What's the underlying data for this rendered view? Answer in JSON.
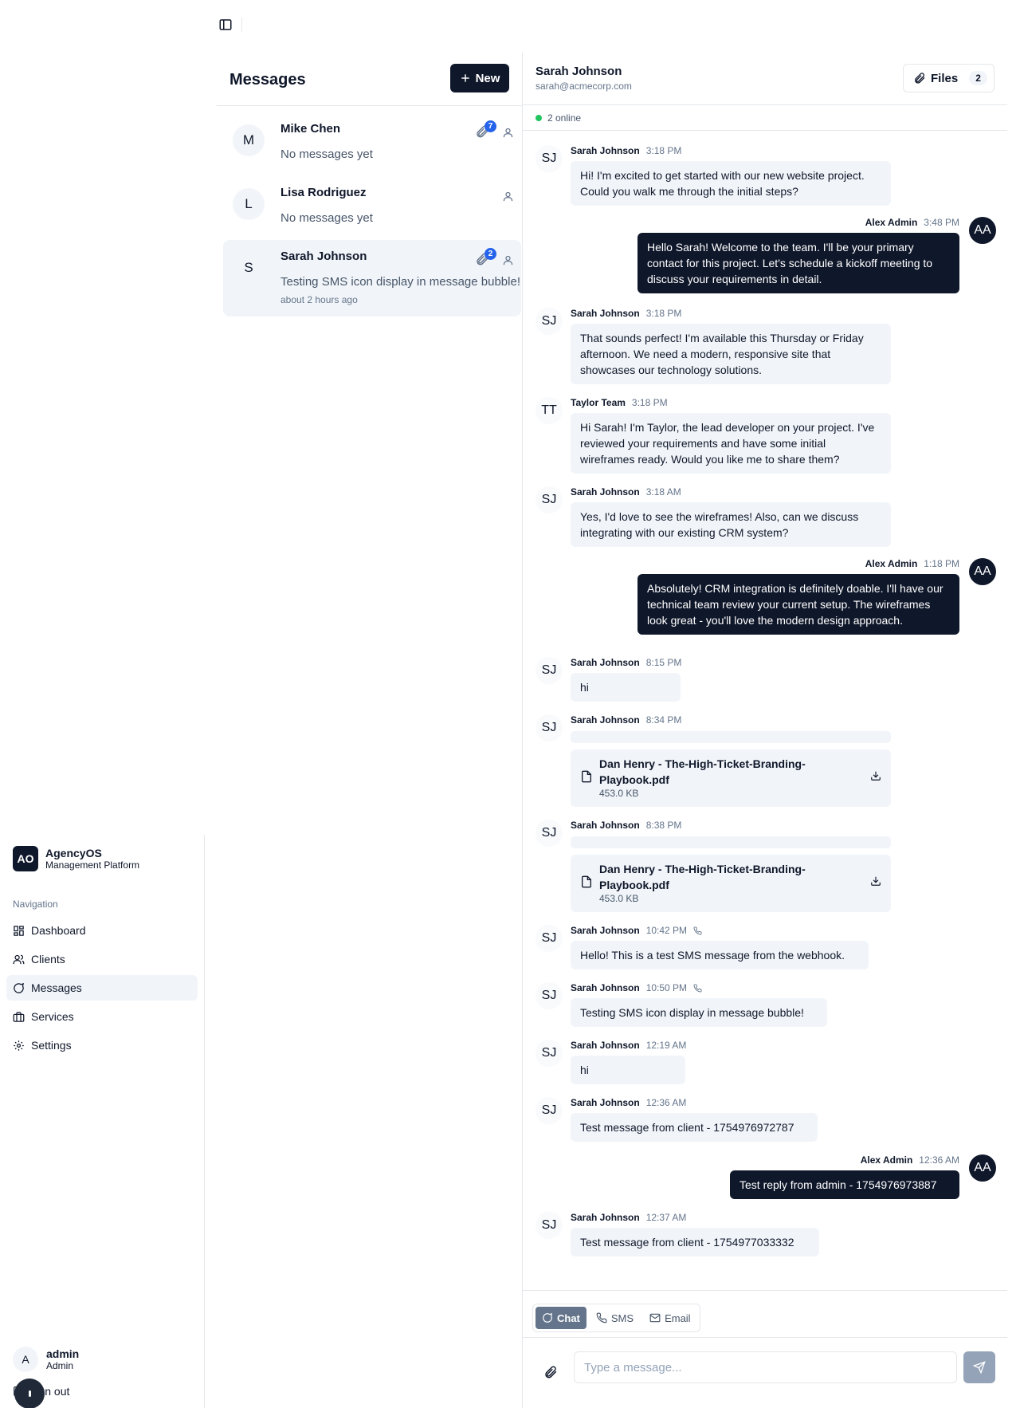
{
  "sidebar": {
    "brand": {
      "logo": "AO",
      "name": "AgencyOS",
      "subtitle": "Management Platform"
    },
    "nav_label": "Navigation",
    "items": [
      {
        "label": "Dashboard",
        "icon": "dashboard-icon"
      },
      {
        "label": "Clients",
        "icon": "users-icon"
      },
      {
        "label": "Messages",
        "icon": "message-icon",
        "active": true
      },
      {
        "label": "Services",
        "icon": "briefcase-icon"
      },
      {
        "label": "Settings",
        "icon": "gear-icon"
      }
    ],
    "user": {
      "avatar": "A",
      "name": "admin",
      "role": "Admin"
    },
    "signout": "Sign out"
  },
  "conversations": {
    "title": "Messages",
    "new_label": "New",
    "items": [
      {
        "avatar": "M",
        "name": "Mike Chen",
        "preview": "No messages yet",
        "time": "",
        "files": "7"
      },
      {
        "avatar": "L",
        "name": "Lisa Rodriguez",
        "preview": "No messages yet",
        "time": ""
      },
      {
        "avatar": "S",
        "name": "Sarah Johnson",
        "preview": "Testing SMS icon display in message bubble!",
        "time": "about 2 hours ago",
        "files": "2",
        "active": true
      }
    ]
  },
  "chat": {
    "contact_name": "Sarah Johnson",
    "contact_email": "sarah@acmecorp.com",
    "files_label": "Files",
    "files_count": "2",
    "online": "2 online",
    "messages": [
      {
        "dir": "in",
        "avatar": "SJ",
        "sender": "Sarah Johnson",
        "time": "3:18 PM",
        "text": "Hi! I'm excited to get started with our new website project. Could you walk me through the initial steps?"
      },
      {
        "dir": "out",
        "avatar": "AA",
        "sender": "Alex Admin",
        "time": "3:48 PM",
        "text": "Hello Sarah! Welcome to the team. I'll be your primary contact for this project. Let's schedule a kickoff meeting to discuss your requirements in detail."
      },
      {
        "dir": "in",
        "avatar": "SJ",
        "sender": "Sarah Johnson",
        "time": "3:18 PM",
        "text": "That sounds perfect! I'm available this Thursday or Friday afternoon. We need a modern, responsive site that showcases our technology solutions."
      },
      {
        "dir": "in",
        "avatar": "TT",
        "sender": "Taylor Team",
        "time": "3:18 PM",
        "text": "Hi Sarah! I'm Taylor, the lead developer on your project. I've reviewed your requirements and have some initial wireframes ready. Would you like me to share them?"
      },
      {
        "dir": "in",
        "avatar": "SJ",
        "sender": "Sarah Johnson",
        "time": "3:18 AM",
        "text": "Yes, I'd love to see the wireframes! Also, can we discuss integrating with our existing CRM system?"
      },
      {
        "dir": "out",
        "avatar": "AA",
        "sender": "Alex Admin",
        "time": "1:18 PM",
        "text": "Absolutely! CRM integration is definitely doable. I'll have our technical team review your current setup. The wireframes look great - you'll love the modern design approach."
      },
      {
        "dir": "in",
        "avatar": "SJ",
        "sender": "Sarah Johnson",
        "time": "8:15 PM",
        "text": "hi"
      },
      {
        "dir": "in",
        "avatar": "SJ",
        "sender": "Sarah Johnson",
        "time": "8:34 PM",
        "file_name": "Dan Henry - The-High-Ticket-Branding-Playbook.pdf",
        "file_size": "453.0 KB"
      },
      {
        "dir": "in",
        "avatar": "SJ",
        "sender": "Sarah Johnson",
        "time": "8:38 PM",
        "file_name": "Dan Henry - The-High-Ticket-Branding-Playbook.pdf",
        "file_size": "453.0 KB"
      },
      {
        "dir": "in",
        "avatar": "SJ",
        "sender": "Sarah Johnson",
        "time": "10:42 PM",
        "sms": true,
        "text": "Hello! This is a test SMS message from the webhook."
      },
      {
        "dir": "in",
        "avatar": "SJ",
        "sender": "Sarah Johnson",
        "time": "10:50 PM",
        "sms": true,
        "text": "Testing SMS icon display in message bubble!"
      },
      {
        "dir": "in",
        "avatar": "SJ",
        "sender": "Sarah Johnson",
        "time": "12:19 AM",
        "text": "hi"
      },
      {
        "dir": "in",
        "avatar": "SJ",
        "sender": "Sarah Johnson",
        "time": "12:36 AM",
        "text": "Test message from client - 1754976972787"
      },
      {
        "dir": "out",
        "avatar": "AA",
        "sender": "Alex Admin",
        "time": "12:36 AM",
        "text": "Test reply from admin - 1754976973887"
      },
      {
        "dir": "in",
        "avatar": "SJ",
        "sender": "Sarah Johnson",
        "time": "12:37 AM",
        "text": "Test message from client - 1754977033332"
      }
    ]
  },
  "compose": {
    "modes": [
      {
        "label": "Chat",
        "icon": "chat-icon",
        "active": true
      },
      {
        "label": "SMS",
        "icon": "phone-icon"
      },
      {
        "label": "Email",
        "icon": "mail-icon"
      }
    ],
    "placeholder": "Type a message..."
  }
}
